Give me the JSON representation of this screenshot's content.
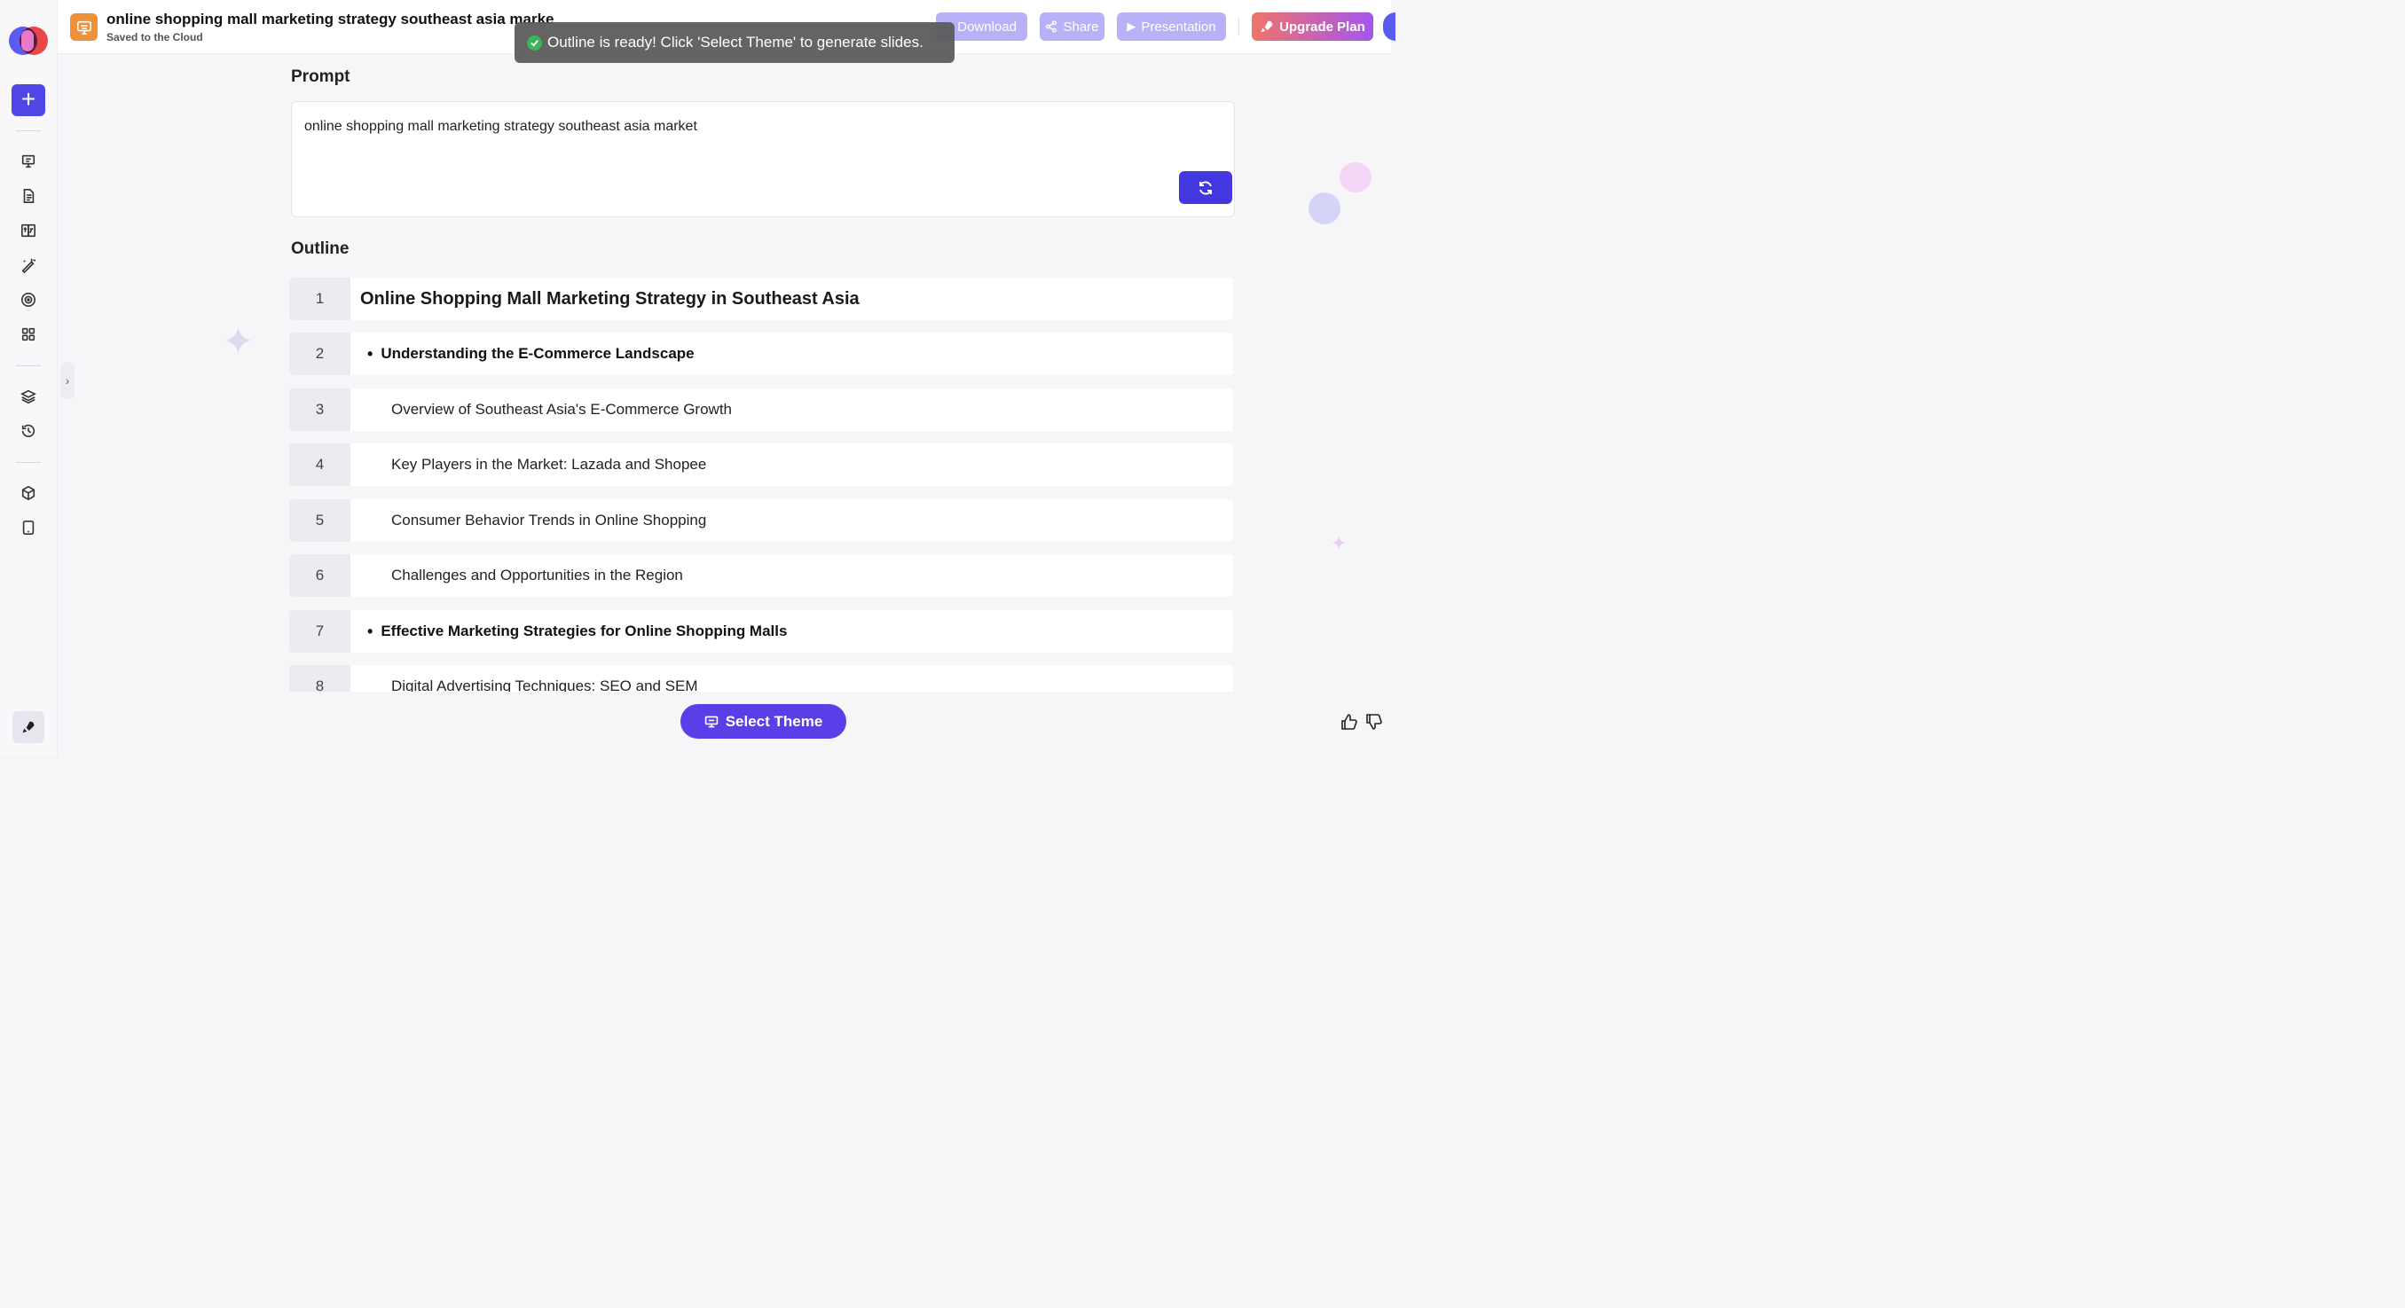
{
  "sidebar": {
    "icons": [
      "presentation-icon",
      "document-icon",
      "translate-icon",
      "magic-pen-icon",
      "target-icon",
      "grid-icon",
      "layers-icon",
      "history-icon",
      "box-icon",
      "tablet-icon"
    ]
  },
  "header": {
    "title": "online shopping mall marketing strategy southeast asia marke",
    "subtitle": "Saved to the Cloud",
    "download_label": "Download",
    "share_label": "Share",
    "presentation_label": "Presentation",
    "upgrade_label": "Upgrade Plan"
  },
  "toast": {
    "message": "Outline is ready! Click 'Select Theme' to generate slides."
  },
  "prompt": {
    "heading": "Prompt",
    "value": "online shopping mall marketing strategy southeast asia market"
  },
  "outline": {
    "heading": "Outline",
    "items": [
      {
        "num": "1",
        "text": "Online Shopping Mall Marketing Strategy in Southeast Asia",
        "kind": "title"
      },
      {
        "num": "2",
        "text": "Understanding the E-Commerce Landscape",
        "kind": "bullet"
      },
      {
        "num": "3",
        "text": "Overview of Southeast Asia's E-Commerce Growth",
        "kind": "sub"
      },
      {
        "num": "4",
        "text": "Key Players in the Market: Lazada and Shopee",
        "kind": "sub"
      },
      {
        "num": "5",
        "text": "Consumer Behavior Trends in Online Shopping",
        "kind": "sub"
      },
      {
        "num": "6",
        "text": "Challenges and Opportunities in the Region",
        "kind": "sub"
      },
      {
        "num": "7",
        "text": "Effective Marketing Strategies for Online Shopping Malls",
        "kind": "bullet"
      },
      {
        "num": "8",
        "text": "Digital Advertising Techniques: SEO and SEM",
        "kind": "sub"
      }
    ]
  },
  "footer": {
    "select_theme_label": "Select Theme"
  },
  "colors": {
    "accent": "#4f46e5",
    "header_button": "#b7b1f7",
    "doc_icon": "#f0913a",
    "select_theme": "#5a3ee8"
  }
}
